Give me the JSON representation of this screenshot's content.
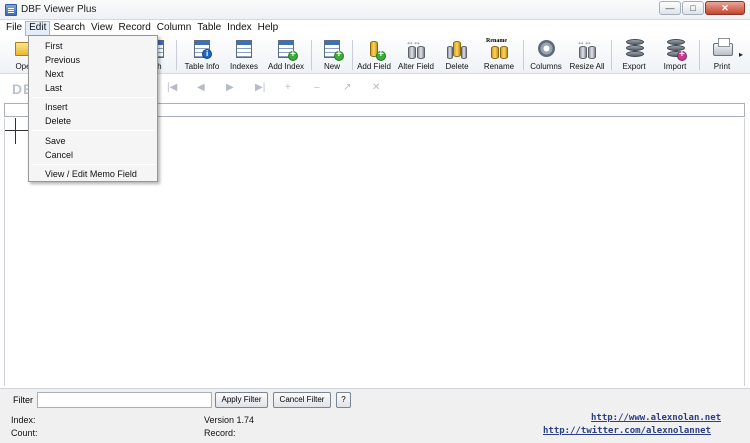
{
  "window": {
    "title": "DBF Viewer Plus"
  },
  "menubar": [
    {
      "label": "File",
      "key": "F"
    },
    {
      "label": "Edit",
      "key": "E"
    },
    {
      "label": "Search",
      "key": "S"
    },
    {
      "label": "View",
      "key": "V"
    },
    {
      "label": "Record",
      "key": "R"
    },
    {
      "label": "Column",
      "key": "C"
    },
    {
      "label": "Table",
      "key": "T"
    },
    {
      "label": "Index",
      "key": "I"
    },
    {
      "label": "Help",
      "key": "H"
    }
  ],
  "toolbar": {
    "open": "Ope",
    "search": "rch",
    "table_info": "Table Info",
    "indexes": "Indexes",
    "add_index": "Add Index",
    "new": "New",
    "add_field": "Add Field",
    "alter_field": "Alter Field",
    "delete": "Delete",
    "rename": "Rename",
    "rename_word": "Rename",
    "columns": "Columns",
    "resize_all": "Resize All",
    "export": "Export",
    "import": "Import",
    "print": "Print"
  },
  "navrow": {
    "logo_text": "DB"
  },
  "dropdown": {
    "items": [
      "First",
      "Previous",
      "Next",
      "Last",
      "Insert",
      "Delete",
      "Save",
      "Cancel",
      "View / Edit Memo Field"
    ]
  },
  "filterbar": {
    "label": "Filter",
    "value": "",
    "apply": "Apply Filter",
    "cancel": "Cancel Filter",
    "help": "?"
  },
  "status": {
    "index_label": "Index:",
    "count_label": "Count:",
    "version": "Version 1.74",
    "record_label": "Record:",
    "website": "http://www.alexnolan.net",
    "twitter": "http://twitter.com/alexnolannet"
  },
  "colors": {
    "accent": "#3f6fb5",
    "link": "#2b3f86"
  }
}
